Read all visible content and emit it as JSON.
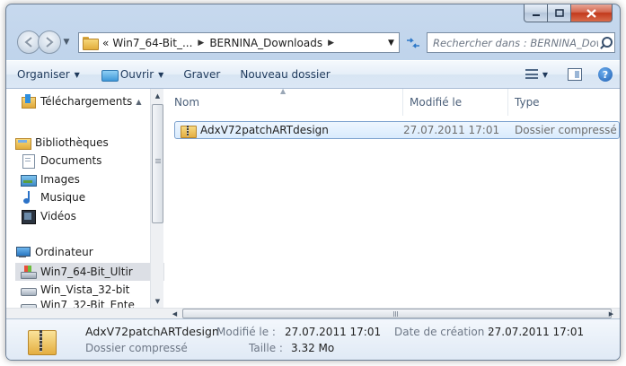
{
  "address": {
    "overflow_marker": "«",
    "crumbs": [
      "Win7_64-Bit_...",
      "BERNINA_Downloads"
    ],
    "search_placeholder": "Rechercher dans : BERNINA_Downloads"
  },
  "toolbar": {
    "organize_label": "Organiser",
    "open_label": "Ouvrir",
    "burn_label": "Graver",
    "new_folder_label": "Nouveau dossier"
  },
  "nav_pane": {
    "items": [
      {
        "label": "Téléchargements",
        "icon": "download-folder-icon"
      },
      {
        "label": "Bibliothèques",
        "icon": "libraries-icon"
      },
      {
        "label": "Documents",
        "icon": "documents-icon"
      },
      {
        "label": "Images",
        "icon": "pictures-icon"
      },
      {
        "label": "Musique",
        "icon": "music-icon"
      },
      {
        "label": "Vidéos",
        "icon": "videos-icon"
      },
      {
        "label": "Ordinateur",
        "icon": "computer-icon"
      },
      {
        "label": "Win7_64-Bit_Ultir",
        "icon": "windows-drive-icon"
      },
      {
        "label": "Win_Vista_32-bit",
        "icon": "drive-icon"
      },
      {
        "label": "Win7_32-Bit_Ente",
        "icon": "drive-icon"
      }
    ]
  },
  "columns": {
    "name": "Nom",
    "modified": "Modifié le",
    "type": "Type"
  },
  "files": [
    {
      "name": "AdxV72patchARTdesign",
      "modified": "27.07.2011 17:01",
      "type": "Dossier compressé"
    }
  ],
  "details": {
    "name": "AdxV72patchARTdesign",
    "type": "Dossier compressé",
    "modified_label": "Modifié le :",
    "modified_value": "27.07.2011 17:01",
    "size_label": "Taille :",
    "size_value": "3.32 Mo",
    "created_label": "Date de création :",
    "created_value": "27.07.2011 17:01"
  },
  "colors": {
    "frame": "#bcd1ea",
    "selection": "#d9ebfd",
    "close_button": "#c2391b"
  }
}
